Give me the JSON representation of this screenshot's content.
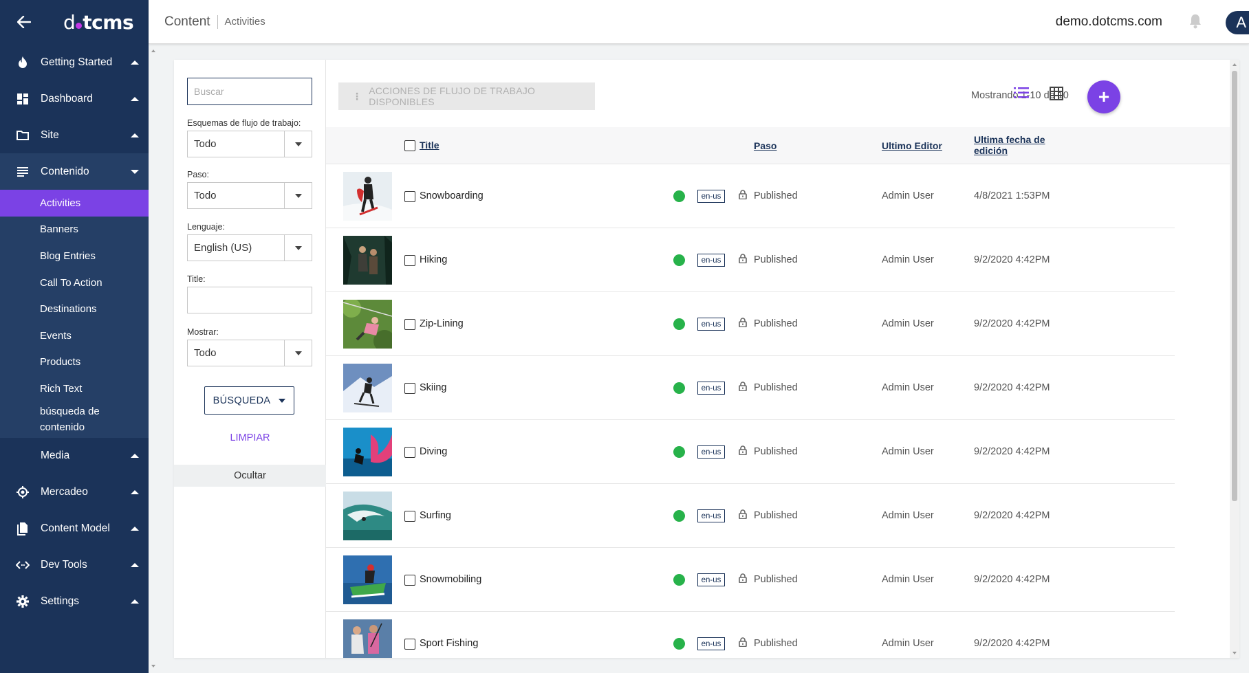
{
  "app": {
    "logo_prefix": "d",
    "logo_suffix": "tcms",
    "site_name": "demo.dotcms.com",
    "avatar_initial": "A",
    "accent_color": "#7b42e5",
    "sidebar_color": "#1b3359"
  },
  "breadcrumb": {
    "main": "Content",
    "sub": "Activities"
  },
  "sidebar": {
    "sections": [
      {
        "label": "Getting Started",
        "icon": "flame-icon"
      },
      {
        "label": "Dashboard",
        "icon": "dashboard-icon"
      },
      {
        "label": "Site",
        "icon": "folder-icon"
      },
      {
        "label": "Contenido",
        "icon": "list-icon"
      },
      {
        "label": "Media",
        "icon": "none"
      },
      {
        "label": "Mercadeo",
        "icon": "target-icon"
      },
      {
        "label": "Content Model",
        "icon": "file-copy-icon"
      },
      {
        "label": "Dev Tools",
        "icon": "code-icon"
      },
      {
        "label": "Settings",
        "icon": "gear-icon"
      }
    ],
    "subitems": [
      "Activities",
      "Banners",
      "Blog Entries",
      "Call To Action",
      "Destinations",
      "Events",
      "Products",
      "Rich Text",
      "búsqueda de contenido"
    ]
  },
  "filters": {
    "search_placeholder": "Buscar",
    "workflow_label": "Esquemas de flujo de trabajo:",
    "workflow_value": "Todo",
    "step_label": "Paso:",
    "step_value": "Todo",
    "language_label": "Lenguaje:",
    "language_value": "English (US)",
    "title_label": "Title:",
    "title_value": "",
    "show_label": "Mostrar:",
    "show_value": "Todo",
    "search_button": "BÚSQUEDA",
    "clear_link": "LIMPIAR",
    "hide_button": "Ocultar"
  },
  "toolbar": {
    "actions_button": "ACCIONES DE FLUJO DE TRABAJO DISPONIBLES",
    "showing_text": "Mostrando 1-10 de 10",
    "add_label": "+"
  },
  "table": {
    "columns": {
      "title": "Title",
      "step": "Paso",
      "editor": "Ultimo Editor",
      "date_line1": "Ultima fecha de",
      "date_line2": "edición"
    },
    "rows": [
      {
        "title": "Snowboarding",
        "lang": "en-us",
        "step": "Published",
        "editor": "Admin User",
        "date": "4/8/2021 1:53PM"
      },
      {
        "title": "Hiking",
        "lang": "en-us",
        "step": "Published",
        "editor": "Admin User",
        "date": "9/2/2020 4:42PM"
      },
      {
        "title": "Zip-Lining",
        "lang": "en-us",
        "step": "Published",
        "editor": "Admin User",
        "date": "9/2/2020 4:42PM"
      },
      {
        "title": "Skiing",
        "lang": "en-us",
        "step": "Published",
        "editor": "Admin User",
        "date": "9/2/2020 4:42PM"
      },
      {
        "title": "Diving",
        "lang": "en-us",
        "step": "Published",
        "editor": "Admin User",
        "date": "9/2/2020 4:42PM"
      },
      {
        "title": "Surfing",
        "lang": "en-us",
        "step": "Published",
        "editor": "Admin User",
        "date": "9/2/2020 4:42PM"
      },
      {
        "title": "Snowmobiling",
        "lang": "en-us",
        "step": "Published",
        "editor": "Admin User",
        "date": "9/2/2020 4:42PM"
      },
      {
        "title": "Sport Fishing",
        "lang": "en-us",
        "step": "Published",
        "editor": "Admin User",
        "date": "9/2/2020 4:42PM"
      }
    ]
  }
}
